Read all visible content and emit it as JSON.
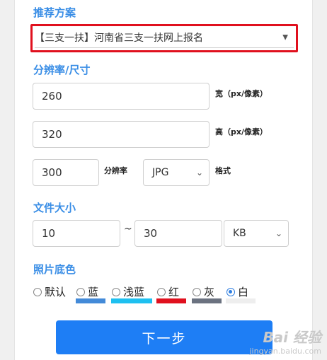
{
  "recommend": {
    "title": "推荐方案",
    "selected": "【三支一扶】河南省三支一扶网上报名"
  },
  "resolution_section": {
    "title": "分辨率/尺寸",
    "width_value": "260",
    "width_label": "宽（px/像素）",
    "height_value": "320",
    "height_label": "高（px/像素）",
    "dpi_value": "300",
    "dpi_label": "分辨率",
    "format_value": "JPG",
    "format_label": "格式"
  },
  "filesize": {
    "title": "文件大小",
    "min": "10",
    "separator": "~",
    "max": "30",
    "unit": "KB"
  },
  "bgcolor": {
    "title": "照片底色",
    "options": [
      {
        "label": "默认",
        "color": ""
      },
      {
        "label": "蓝",
        "color": "#438ad8"
      },
      {
        "label": "浅蓝",
        "color": "#1ec0f0"
      },
      {
        "label": "红",
        "color": "#e0101e"
      },
      {
        "label": "灰",
        "color": "#6b7280"
      },
      {
        "label": "白",
        "color": "#eeeeee"
      }
    ],
    "selected": "白"
  },
  "next_button": "下一步",
  "watermark": {
    "brand": "Bai 经验",
    "domain": "jingyan.baidu.com"
  },
  "colors": {
    "accent": "#3a8ee6",
    "button": "#1e7ef5",
    "highlight": "#e0101e"
  }
}
